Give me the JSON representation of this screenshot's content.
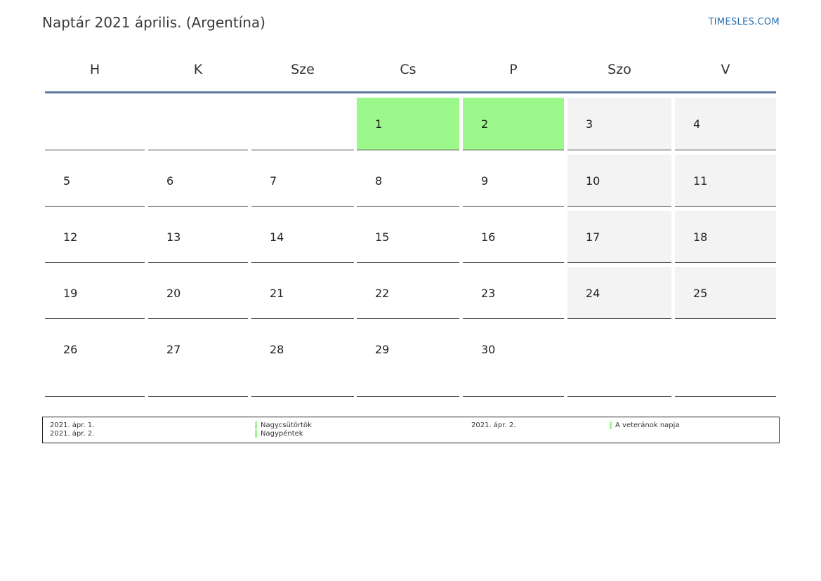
{
  "title": "Naptár 2021 április. (Argentína)",
  "brand": "TIMESLES.COM",
  "colors": {
    "holiday": "#9cf88a",
    "weekend": "#f3f3f3",
    "header_rule": "#5b7aa0",
    "brand": "#2a6fb0"
  },
  "weekdays": [
    "H",
    "K",
    "Sze",
    "Cs",
    "P",
    "Szo",
    "V"
  ],
  "weeks": [
    [
      "",
      "",
      "",
      "1",
      "2",
      "3",
      "4"
    ],
    [
      "5",
      "6",
      "7",
      "8",
      "9",
      "10",
      "11"
    ],
    [
      "12",
      "13",
      "14",
      "15",
      "16",
      "17",
      "18"
    ],
    [
      "19",
      "20",
      "21",
      "22",
      "23",
      "24",
      "25"
    ],
    [
      "26",
      "27",
      "28",
      "29",
      "30",
      "",
      ""
    ]
  ],
  "holidays": [
    "1",
    "2"
  ],
  "legend": {
    "left": [
      {
        "date": "2021. ápr. 1.",
        "name": "Nagycsütörtök"
      },
      {
        "date": "2021. ápr. 2.",
        "name": "Nagypéntek"
      }
    ],
    "right": [
      {
        "date": "2021. ápr. 2.",
        "name": "A veteránok napja"
      }
    ]
  }
}
